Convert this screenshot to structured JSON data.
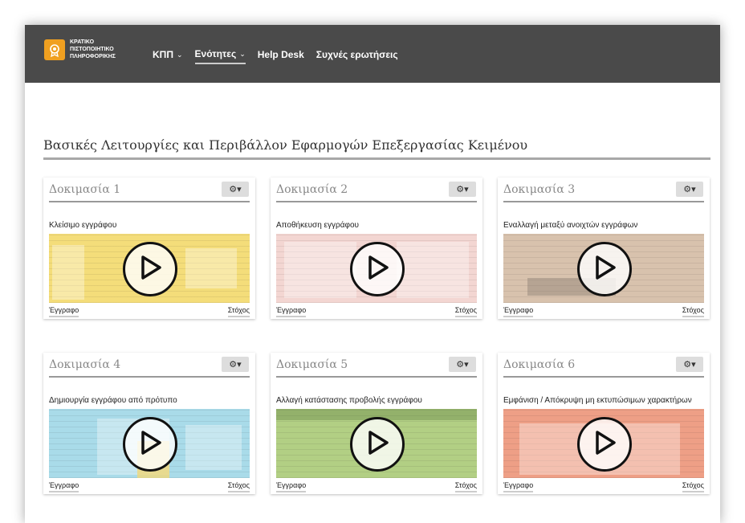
{
  "header": {
    "logo_lines": [
      "ΚΡΑΤΙΚΟ",
      "ΠΙΣΤΟΠΟΙΗΤΙΚΟ",
      "ΠΛΗΡΟΦΟΡΙΚΗΣ"
    ],
    "nav": [
      {
        "label": "ΚΠΠ",
        "dropdown": true
      },
      {
        "label": "Ενότητες",
        "dropdown": true,
        "active": true
      },
      {
        "label": "Help Desk",
        "dropdown": false
      },
      {
        "label": "Συχνές ερωτήσεις",
        "dropdown": false
      }
    ]
  },
  "section": {
    "title": "Βασικές Λειτουργίες και Περιβάλλον Εφαρμογών Επεξεργασίας Κειμένου"
  },
  "cards": [
    {
      "title": "Δοκιμασία 1",
      "task": "Κλείσιμο εγγράφου",
      "thumb_color": "#f4dd7a",
      "left_link": "Έγγραφο",
      "right_link": "Στόχος"
    },
    {
      "title": "Δοκιμασία 2",
      "task": "Αποθήκευση εγγράφου",
      "thumb_color": "#f3d6d2",
      "left_link": "Έγγραφο",
      "right_link": "Στόχος"
    },
    {
      "title": "Δοκιμασία 3",
      "task": "Εναλλαγή μεταξύ ανοιχτών εγγράφων",
      "thumb_color": "#d8c2ad",
      "left_link": "Έγγραφο",
      "right_link": "Στόχος"
    },
    {
      "title": "Δοκιμασία 4",
      "task": "Δημιουργία εγγράφου από πρότυπο",
      "thumb_color": "#a9dbe9",
      "left_link": "Έγγραφο",
      "right_link": "Στόχος"
    },
    {
      "title": "Δοκιμασία 5",
      "task": "Αλλαγή κατάστασης προβολής εγγράφου",
      "thumb_color": "#b2cf84",
      "left_link": "Έγγραφο",
      "right_link": "Στόχος"
    },
    {
      "title": "Δοκιμασία 6",
      "task": "Εμφάνιση / Απόκρυψη μη εκτυπώσιμων χαρακτήρων",
      "thumb_color": "#ee9f86",
      "left_link": "Έγγραφο",
      "right_link": "Στόχος"
    }
  ],
  "icons": {
    "logo": "certificate-icon",
    "gear": "gear-icon",
    "play": "play-icon",
    "chevron": "chevron-down-icon"
  }
}
